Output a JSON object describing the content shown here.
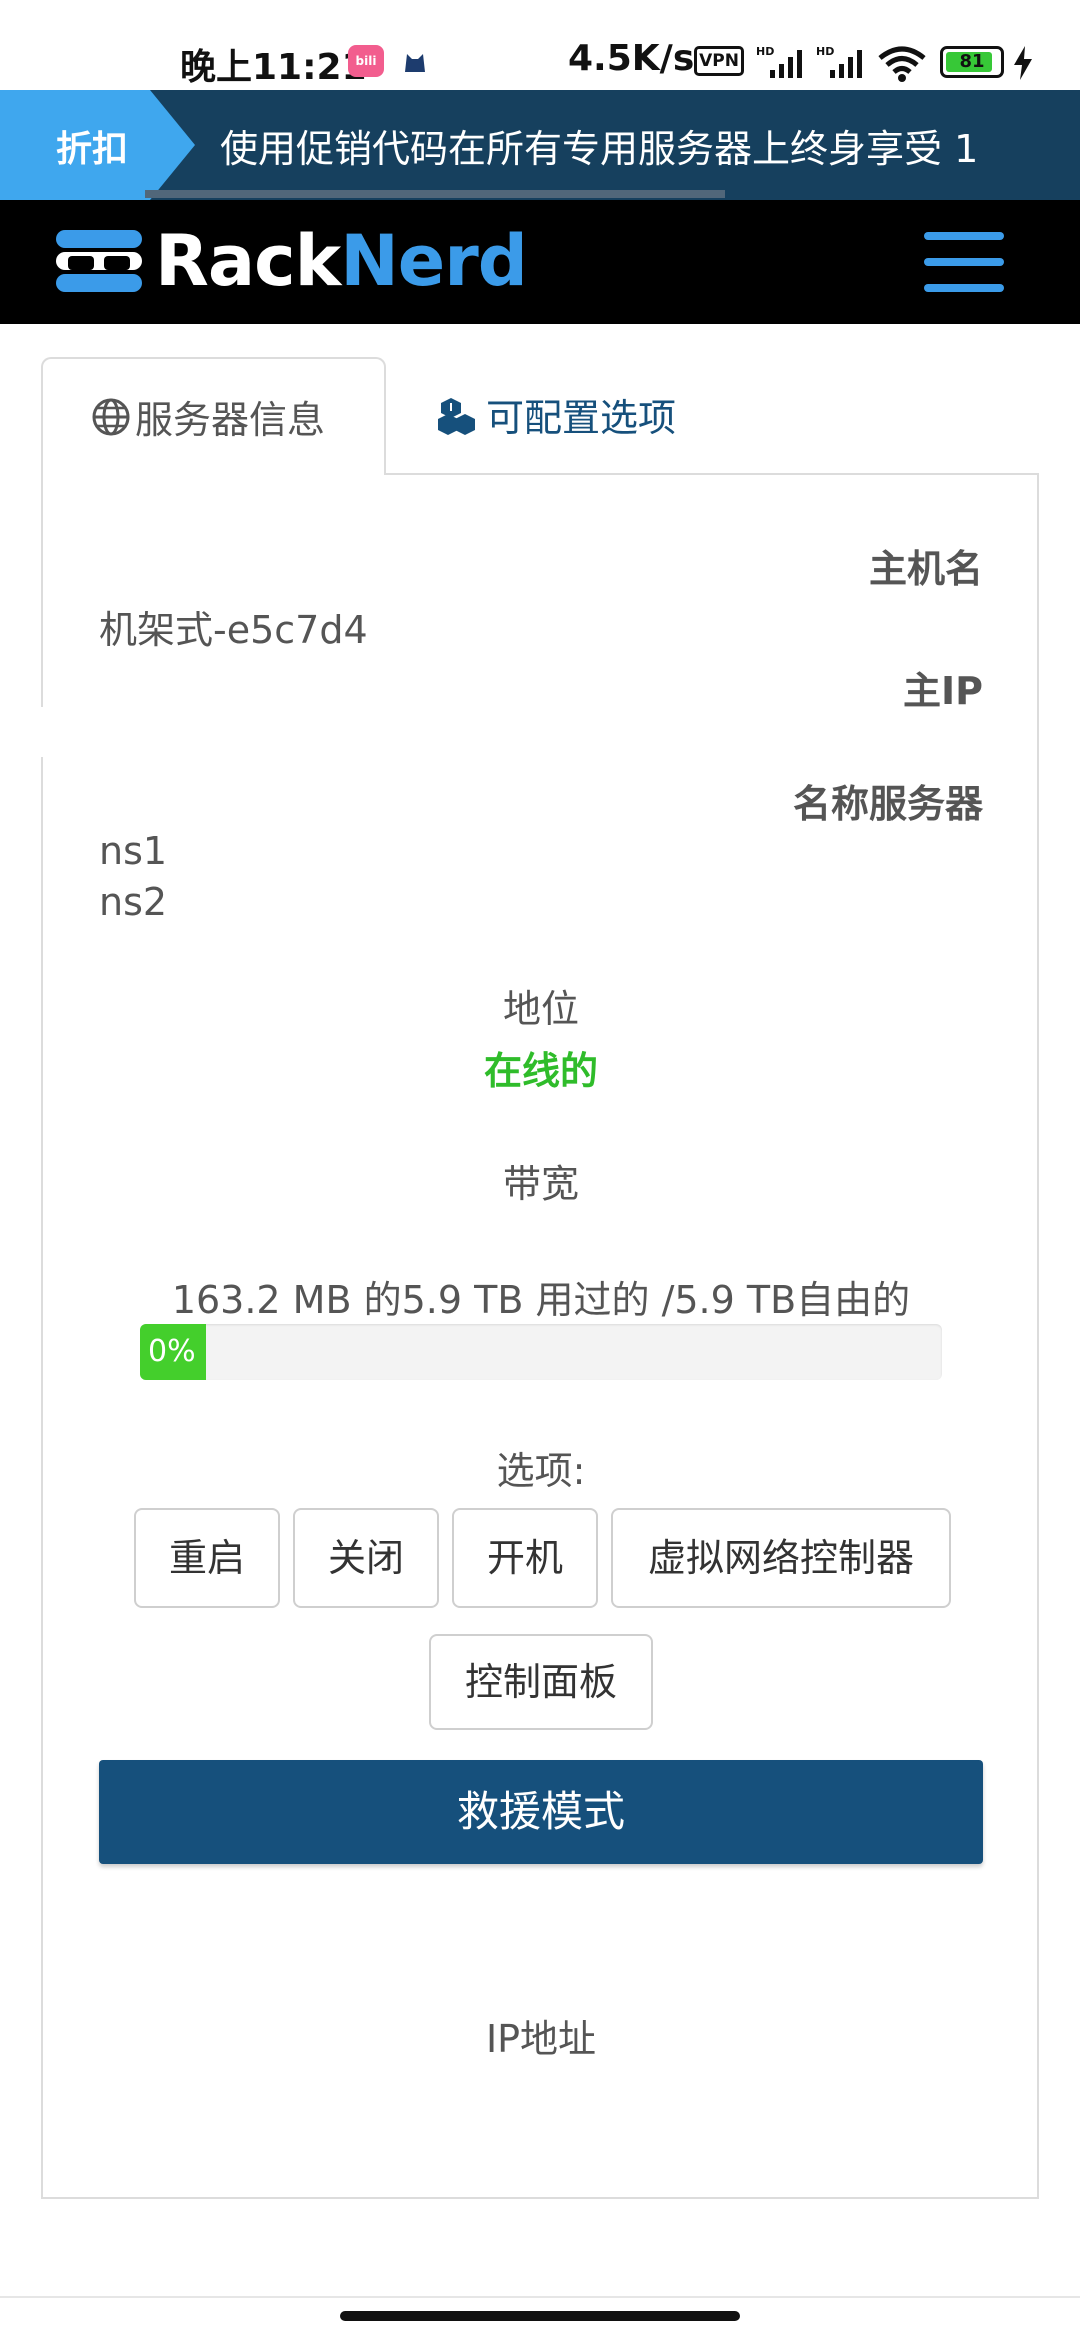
{
  "status_bar": {
    "time": "晚上11:21",
    "app_icon_1": "bilibili-icon",
    "app_icon_2": "cat-icon",
    "net_speed": "4.5K/s",
    "vpn": "VPN",
    "battery": "81",
    "icons": [
      "signal-icon",
      "signal-icon",
      "wifi-icon",
      "battery-icon",
      "charging-icon"
    ]
  },
  "promo": {
    "tag": "折扣",
    "text": "使用促销代码在所有专用服务器上终身享受 1"
  },
  "header": {
    "logo_rack": "Rack",
    "logo_nerd": "Nerd",
    "menu_icon": "hamburger-menu-icon"
  },
  "tabs": [
    {
      "label": "服务器信息",
      "icon": "globe-icon",
      "active": true
    },
    {
      "label": "可配置选项",
      "icon": "cubes-icon",
      "active": false
    }
  ],
  "server": {
    "hostname_label": "主机名",
    "hostname_value": "机架式-e5c7d4",
    "main_ip_label": "主IP",
    "nameservers_label": "名称服务器",
    "nameservers": [
      "ns1",
      "ns2"
    ],
    "status_label": "地位",
    "status_value": "在线的",
    "bandwidth_label": "带宽",
    "bandwidth_usage": "163.2 MB 的5.9 TB 用过的 /5.9 TB自由的",
    "bandwidth_percent": 0,
    "bandwidth_percent_label": "0%",
    "options_label": "选项:",
    "buttons": {
      "reboot": "重启",
      "shutdown": "关闭",
      "boot": "开机",
      "vnc": "虚拟网络控制器",
      "control_panel": "控制面板",
      "rescue": "救援模式"
    },
    "ip_label": "IP地址"
  },
  "colors": {
    "brand_dark": "#16405e",
    "accent_blue": "#3b9be9",
    "status_green": "#2fbc2a",
    "button_blue": "#16507c"
  }
}
